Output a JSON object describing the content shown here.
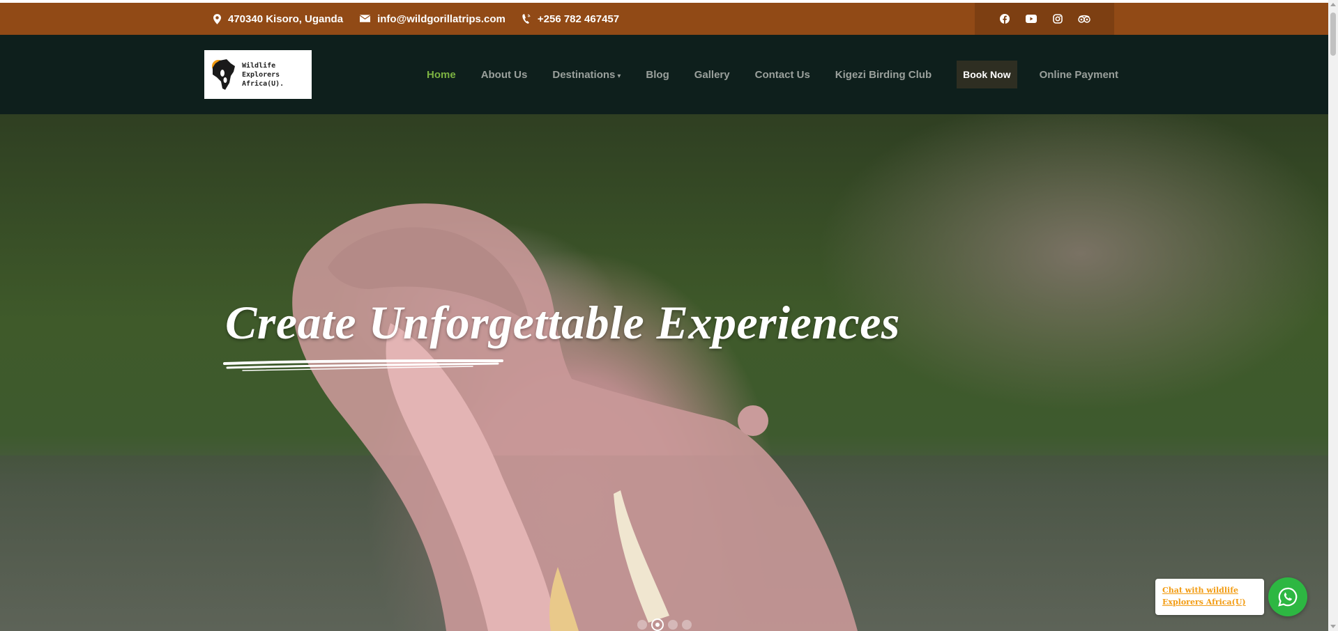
{
  "topbar": {
    "address": "470340 Kisoro, Uganda",
    "email": "info@wildgorillatrips.com",
    "phone": "+256 782 467457",
    "social": [
      "facebook-icon",
      "youtube-icon",
      "instagram-icon",
      "tripadvisor-icon"
    ]
  },
  "logo": {
    "line1": "Wildlife",
    "line2": "Explorers",
    "line3": "Africa(U)."
  },
  "nav": {
    "home": "Home",
    "about": "About Us",
    "destinations": "Destinations",
    "blog": "Blog",
    "gallery": "Gallery",
    "contact": "Contact Us",
    "birding": "Kigezi Birding Club",
    "book": "Book Now",
    "payment": "Online Payment"
  },
  "hero": {
    "title": "Create Unforgettable Experiences",
    "slides_total": 4,
    "active_slide": 2
  },
  "whatsapp": {
    "chat_label": "Chat with wildlife Explorers Africa(U)"
  },
  "colors": {
    "topbar": "#914a16",
    "navbar": "#0e1f1c",
    "active_link": "#7cb342",
    "whatsapp": "#2db742",
    "chat_text": "#f29b11"
  }
}
